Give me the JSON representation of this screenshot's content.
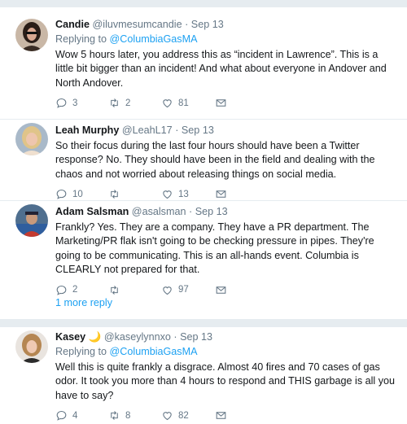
{
  "tweets": [
    {
      "name": "Candie",
      "handle": "@iluvmesumcandie",
      "date": "Sep 13",
      "replying_prefix": "Replying to ",
      "replying_to": "@ColumbiaGasMA",
      "text": "Wow 5 hours later, you address this as “incident in Lawrence”. This is a little bit bigger than an incident! And what about everyone in Andover and North Andover.",
      "replies": "3",
      "retweets": "2",
      "likes": "81"
    },
    {
      "name": "Leah Murphy",
      "handle": "@LeahL17",
      "date": "Sep 13",
      "text": "So their focus during the last four hours should have been a Twitter response? No. They should have been in the field and dealing with the chaos and not worried about releasing things on social media.",
      "replies": "10",
      "retweets": "",
      "likes": "13"
    },
    {
      "name": "Adam Salsman",
      "handle": "@asalsman",
      "date": "Sep 13",
      "text": "Frankly? Yes. They are a company. They have a PR department. The Marketing/PR flak isn't going to be checking pressure in pipes. They're going to be communicating. This is an all-hands event. Columbia is CLEARLY not prepared for that.",
      "replies": "2",
      "retweets": "",
      "likes": "97"
    },
    {
      "name": "Kasey",
      "name_emoji": "🌙",
      "handle": "@kaseylynnxo",
      "date": "Sep 13",
      "replying_prefix": "Replying to ",
      "replying_to": "@ColumbiaGasMA",
      "text": "Well this is quite frankly a disgrace. Almost 40 fires and 70 cases of gas odor. It took you more than 4 hours to respond and THIS garbage is all you have to say?",
      "replies": "4",
      "retweets": "8",
      "likes": "82"
    }
  ],
  "more_replies": "1 more reply",
  "dot": "·",
  "icons": [
    "reply-icon",
    "retweet-icon",
    "like-icon",
    "dm-icon"
  ],
  "colors": {
    "link": "#1da1f2",
    "muted": "#657786",
    "text": "#14171a",
    "border": "#e6ecf0"
  }
}
